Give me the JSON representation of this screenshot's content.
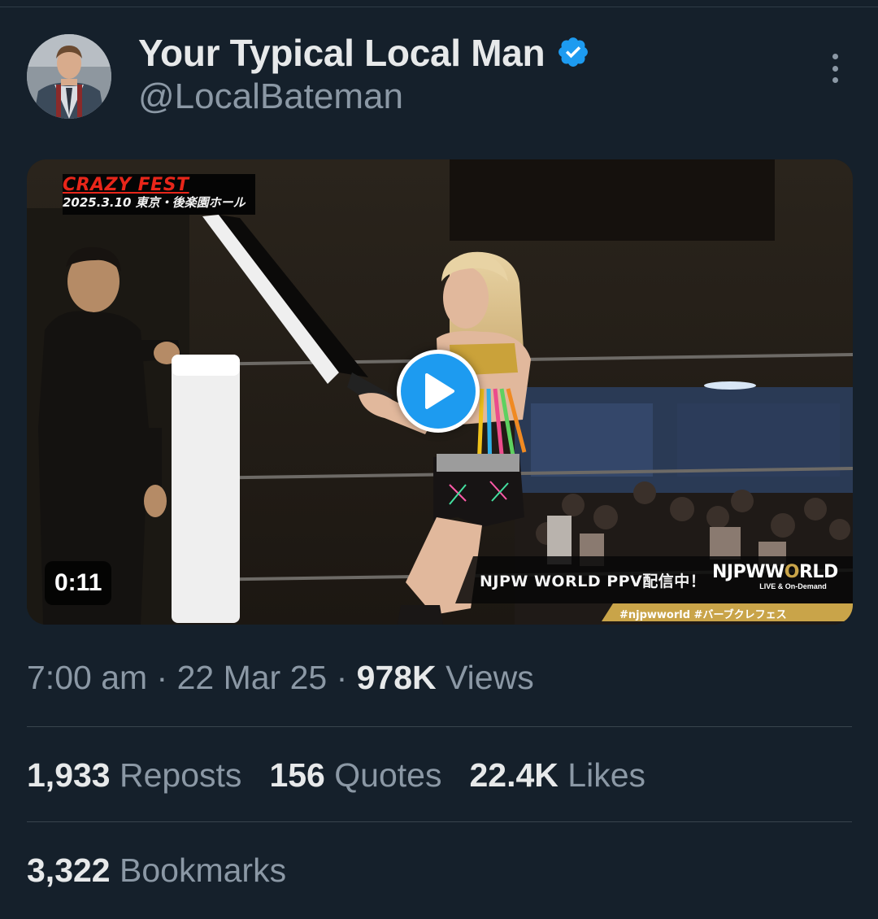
{
  "author": {
    "name": "Your Typical Local Man",
    "handle": "@LocalBateman",
    "verified": true,
    "verified_color": "#1d9bf0"
  },
  "media": {
    "type": "video",
    "duration": "0:11",
    "overlay": {
      "event_title": "CRAZY FEST",
      "event_date": "2025.3.10 東京・後楽園ホール",
      "ppv_text": "NJPW  WORLD PPV配信中！",
      "logo_main_a": "NJPW",
      "logo_main_b": "W",
      "logo_main_c": "RLD",
      "logo_sub": "LIVE & On-Demand",
      "hashtag": "#njpwworld #バーブクレフェス"
    }
  },
  "meta": {
    "time": "7:00 am",
    "separator": " · ",
    "date": "22 Mar 25",
    "views_count": "978K",
    "views_label": "Views"
  },
  "stats": {
    "reposts_count": "1,933",
    "reposts_label": "Reposts",
    "quotes_count": "156",
    "quotes_label": "Quotes",
    "likes_count": "22.4K",
    "likes_label": "Likes",
    "bookmarks_count": "3,322",
    "bookmarks_label": "Bookmarks"
  },
  "colors": {
    "background": "#15202b",
    "text_primary": "#e7e9ea",
    "text_secondary": "#8b98a5",
    "accent": "#1d9bf0"
  }
}
